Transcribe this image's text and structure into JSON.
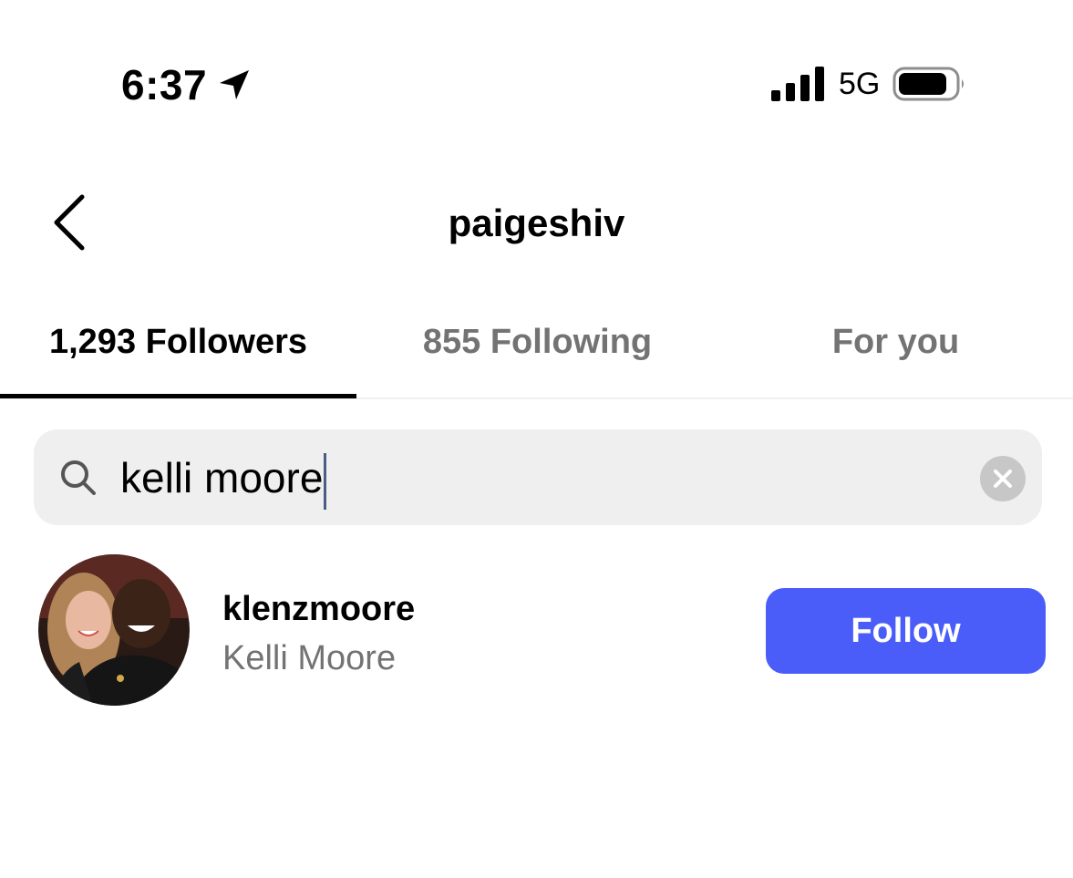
{
  "status_bar": {
    "time": "6:37",
    "network": "5G",
    "icons": [
      "location-arrow-icon",
      "signal-bars-icon",
      "battery-icon"
    ]
  },
  "header": {
    "title": "paigeshiv",
    "back_icon": "chevron-left-icon"
  },
  "tabs": [
    {
      "label": "1,293 Followers",
      "active": true
    },
    {
      "label": "855 Following",
      "active": false
    },
    {
      "label": "For you",
      "active": false
    }
  ],
  "search": {
    "value": "kelli moore",
    "icon": "search-icon",
    "clear_icon": "clear-x-icon"
  },
  "results": [
    {
      "username": "klenzmoore",
      "full_name": "Kelli Moore",
      "action_label": "Follow"
    }
  ],
  "colors": {
    "accent": "#4a5df9",
    "secondary_text": "#737373",
    "search_bg": "#efefef"
  }
}
